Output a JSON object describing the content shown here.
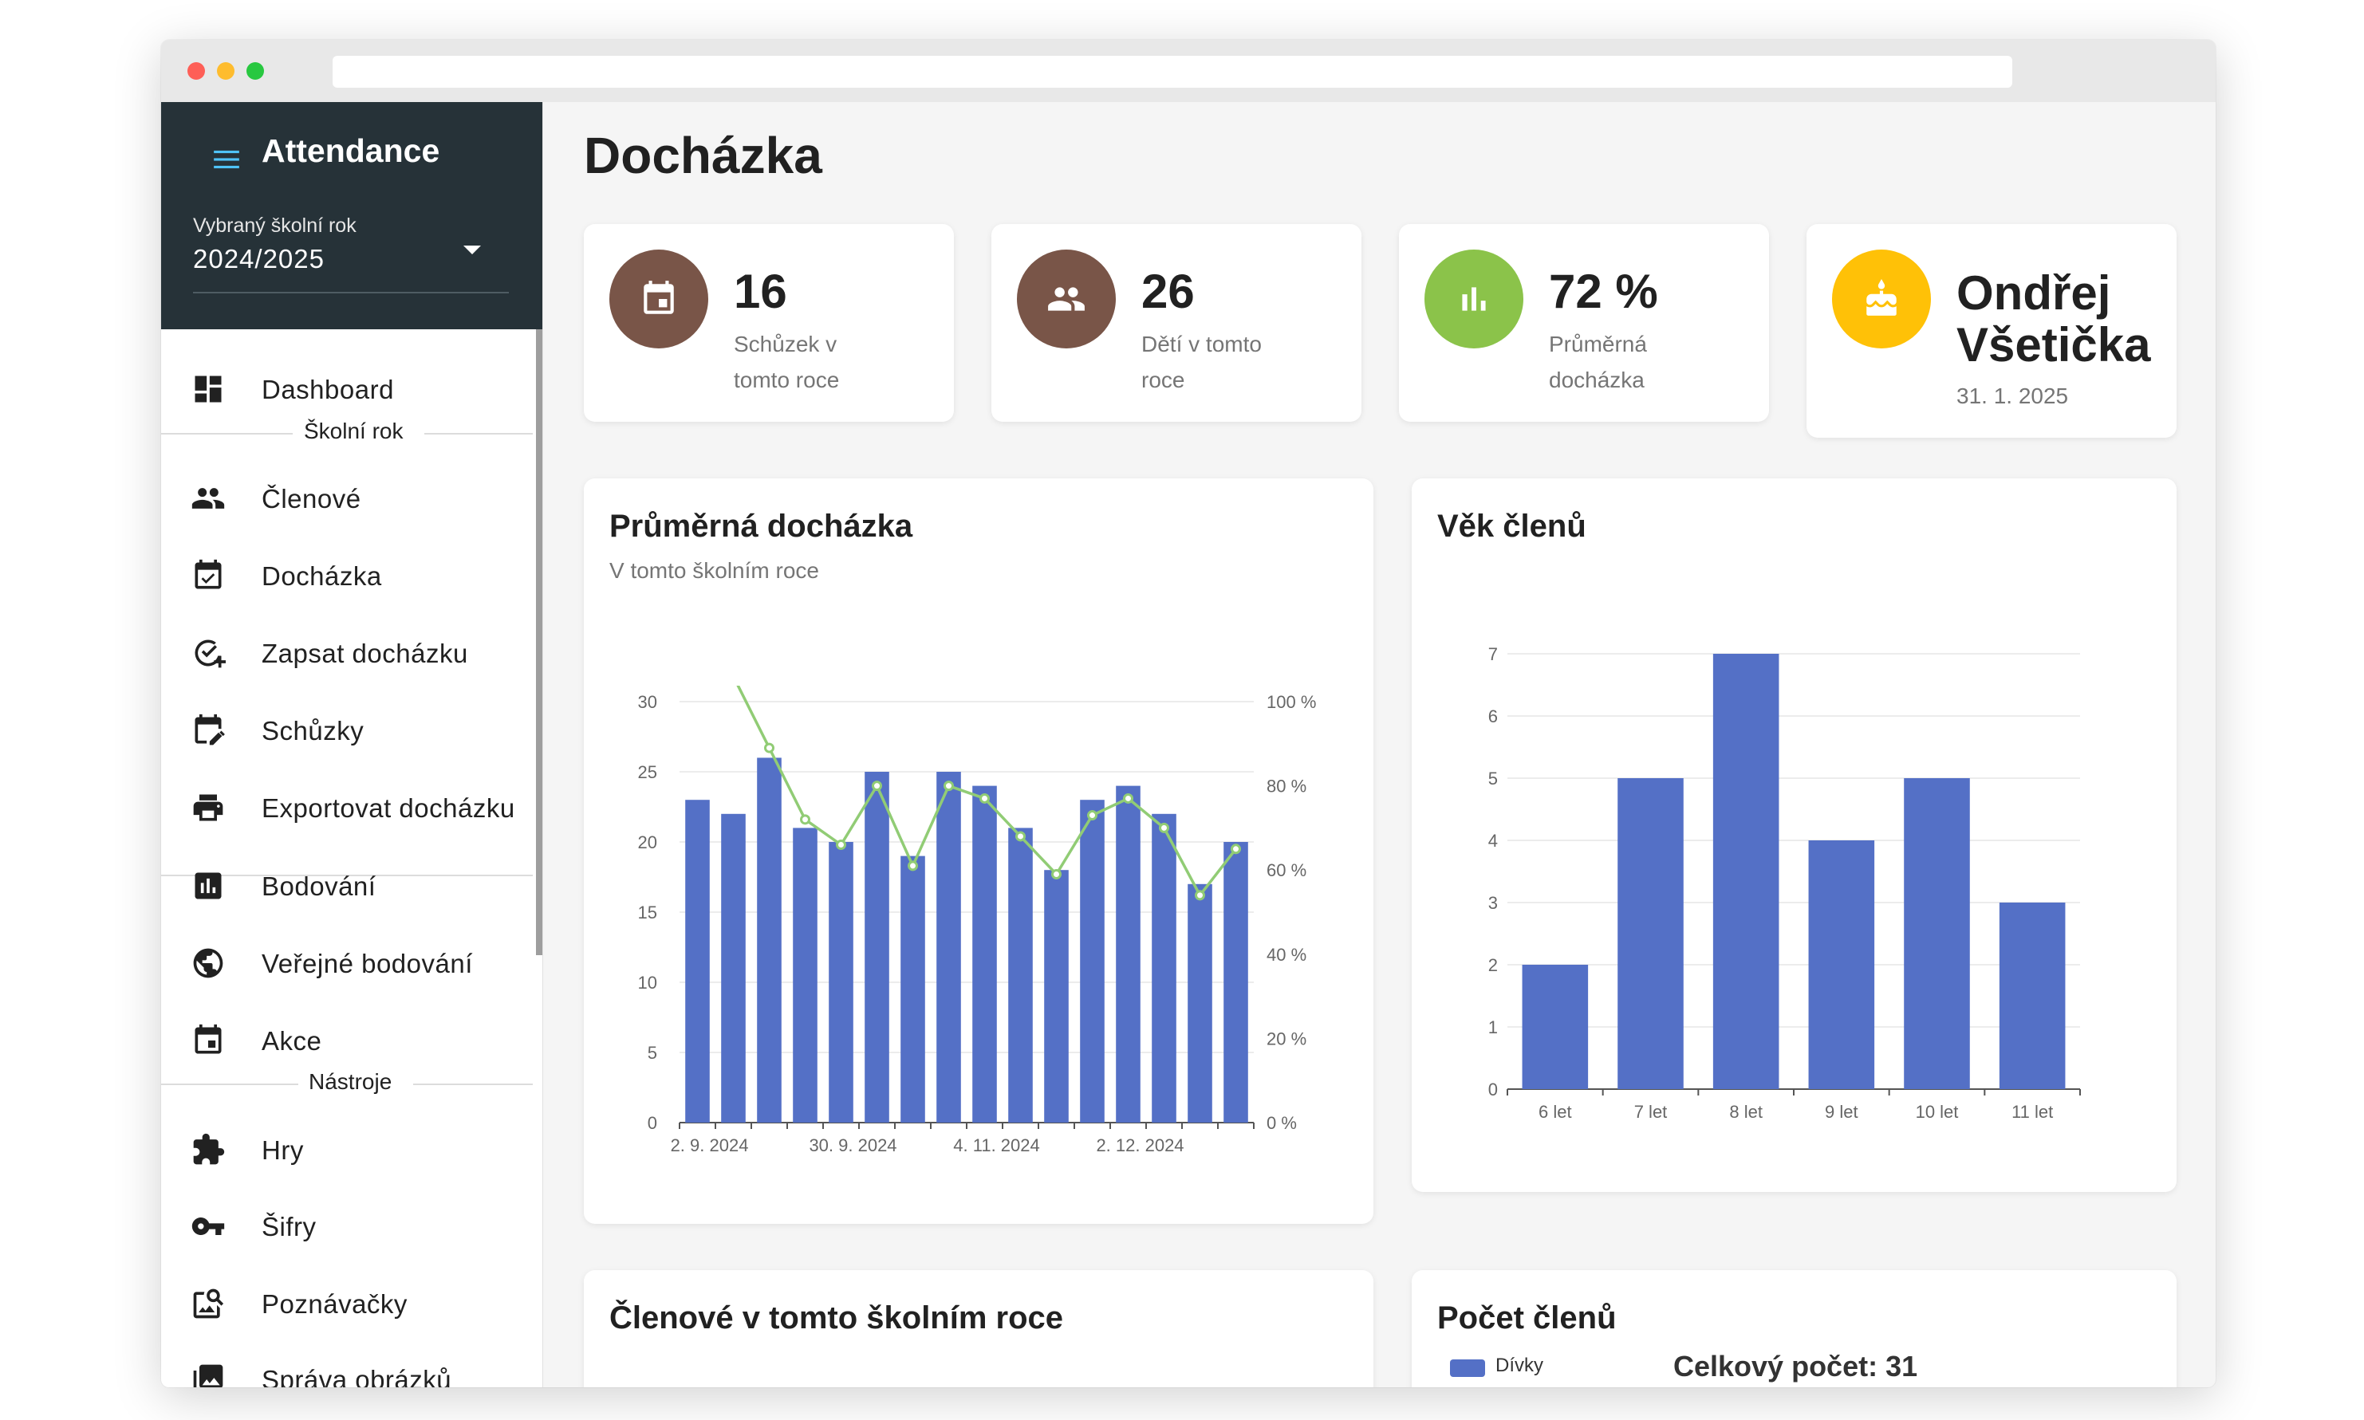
{
  "app": {
    "title": "Attendance"
  },
  "sidebar": {
    "school_year_label": "Vybraný školní rok",
    "school_year_value": "2024/2025",
    "dashboard": "Dashboard",
    "section_year": "Školní rok",
    "members": "Členové",
    "attendance": "Docházka",
    "record_attendance": "Zapsat docházku",
    "meetings": "Schůzky",
    "export_attendance": "Exportovat docházku",
    "scoring": "Bodování",
    "public_scoring": "Veřejné bodování",
    "events": "Akce",
    "section_tools": "Nástroje",
    "games": "Hry",
    "ciphers": "Šifry",
    "quizzes": "Poznávačky",
    "image_management": "Správa obrázků"
  },
  "page": {
    "title": "Docházka"
  },
  "stats": [
    {
      "value": "16",
      "label": "Schůzek v tomto roce",
      "color": "#795548",
      "icon": "calendar-icon"
    },
    {
      "value": "26",
      "label": "Dětí v tomto roce",
      "color": "#795548",
      "icon": "people-icon"
    },
    {
      "value": "72 %",
      "label": "Průměrná docházka",
      "color": "#8bc34a",
      "icon": "bar-chart-icon"
    },
    {
      "value": "Ondřej Všetička",
      "label": "31. 1. 2025",
      "color": "#ffc107",
      "icon": "cake-icon"
    }
  ],
  "birthday": {
    "first": "Ondřej",
    "last": "Všetička"
  },
  "avg_card": {
    "title": "Průměrná docházka",
    "subtitle": "V tomto školním roce"
  },
  "age_card": {
    "title": "Věk členů"
  },
  "members_card": {
    "title": "Členové v tomto školním roce"
  },
  "count_card": {
    "title": "Počet členů",
    "legend_girls": "Dívky",
    "total": "Celkový počet: 31"
  },
  "chart_data": [
    {
      "type": "bar+line",
      "title": "Průměrná docházka",
      "subtitle": "V tomto školním roce",
      "x_tick_labels": [
        "2. 9. 2024",
        "30. 9. 2024",
        "4. 11. 2024",
        "2. 12. 2024"
      ],
      "bar_values": [
        23,
        22,
        26,
        21,
        20,
        25,
        19,
        25,
        24,
        21,
        18,
        23,
        24,
        22,
        17,
        20
      ],
      "line_values_pct": [
        106,
        89,
        72,
        66,
        80,
        61,
        80,
        77,
        68,
        59,
        73,
        77,
        70,
        54,
        65
      ],
      "y_left": {
        "min": 0,
        "max": 30,
        "ticks": [
          0,
          5,
          10,
          15,
          20,
          25,
          30
        ]
      },
      "y_right": {
        "min": 0,
        "max": 100,
        "ticks": [
          "0 %",
          "20 %",
          "40 %",
          "60 %",
          "80 %",
          "100 %"
        ]
      },
      "bar_color": "#5470c6",
      "line_color": "#91cc75"
    },
    {
      "type": "bar",
      "title": "Věk členů",
      "categories": [
        "6 let",
        "7 let",
        "8 let",
        "9 let",
        "10 let",
        "11 let"
      ],
      "values": [
        2,
        5,
        7,
        4,
        5,
        3
      ],
      "ylim": [
        0,
        7
      ],
      "y_ticks": [
        0,
        1,
        2,
        3,
        4,
        5,
        6,
        7
      ],
      "bar_color": "#5470c6"
    }
  ]
}
